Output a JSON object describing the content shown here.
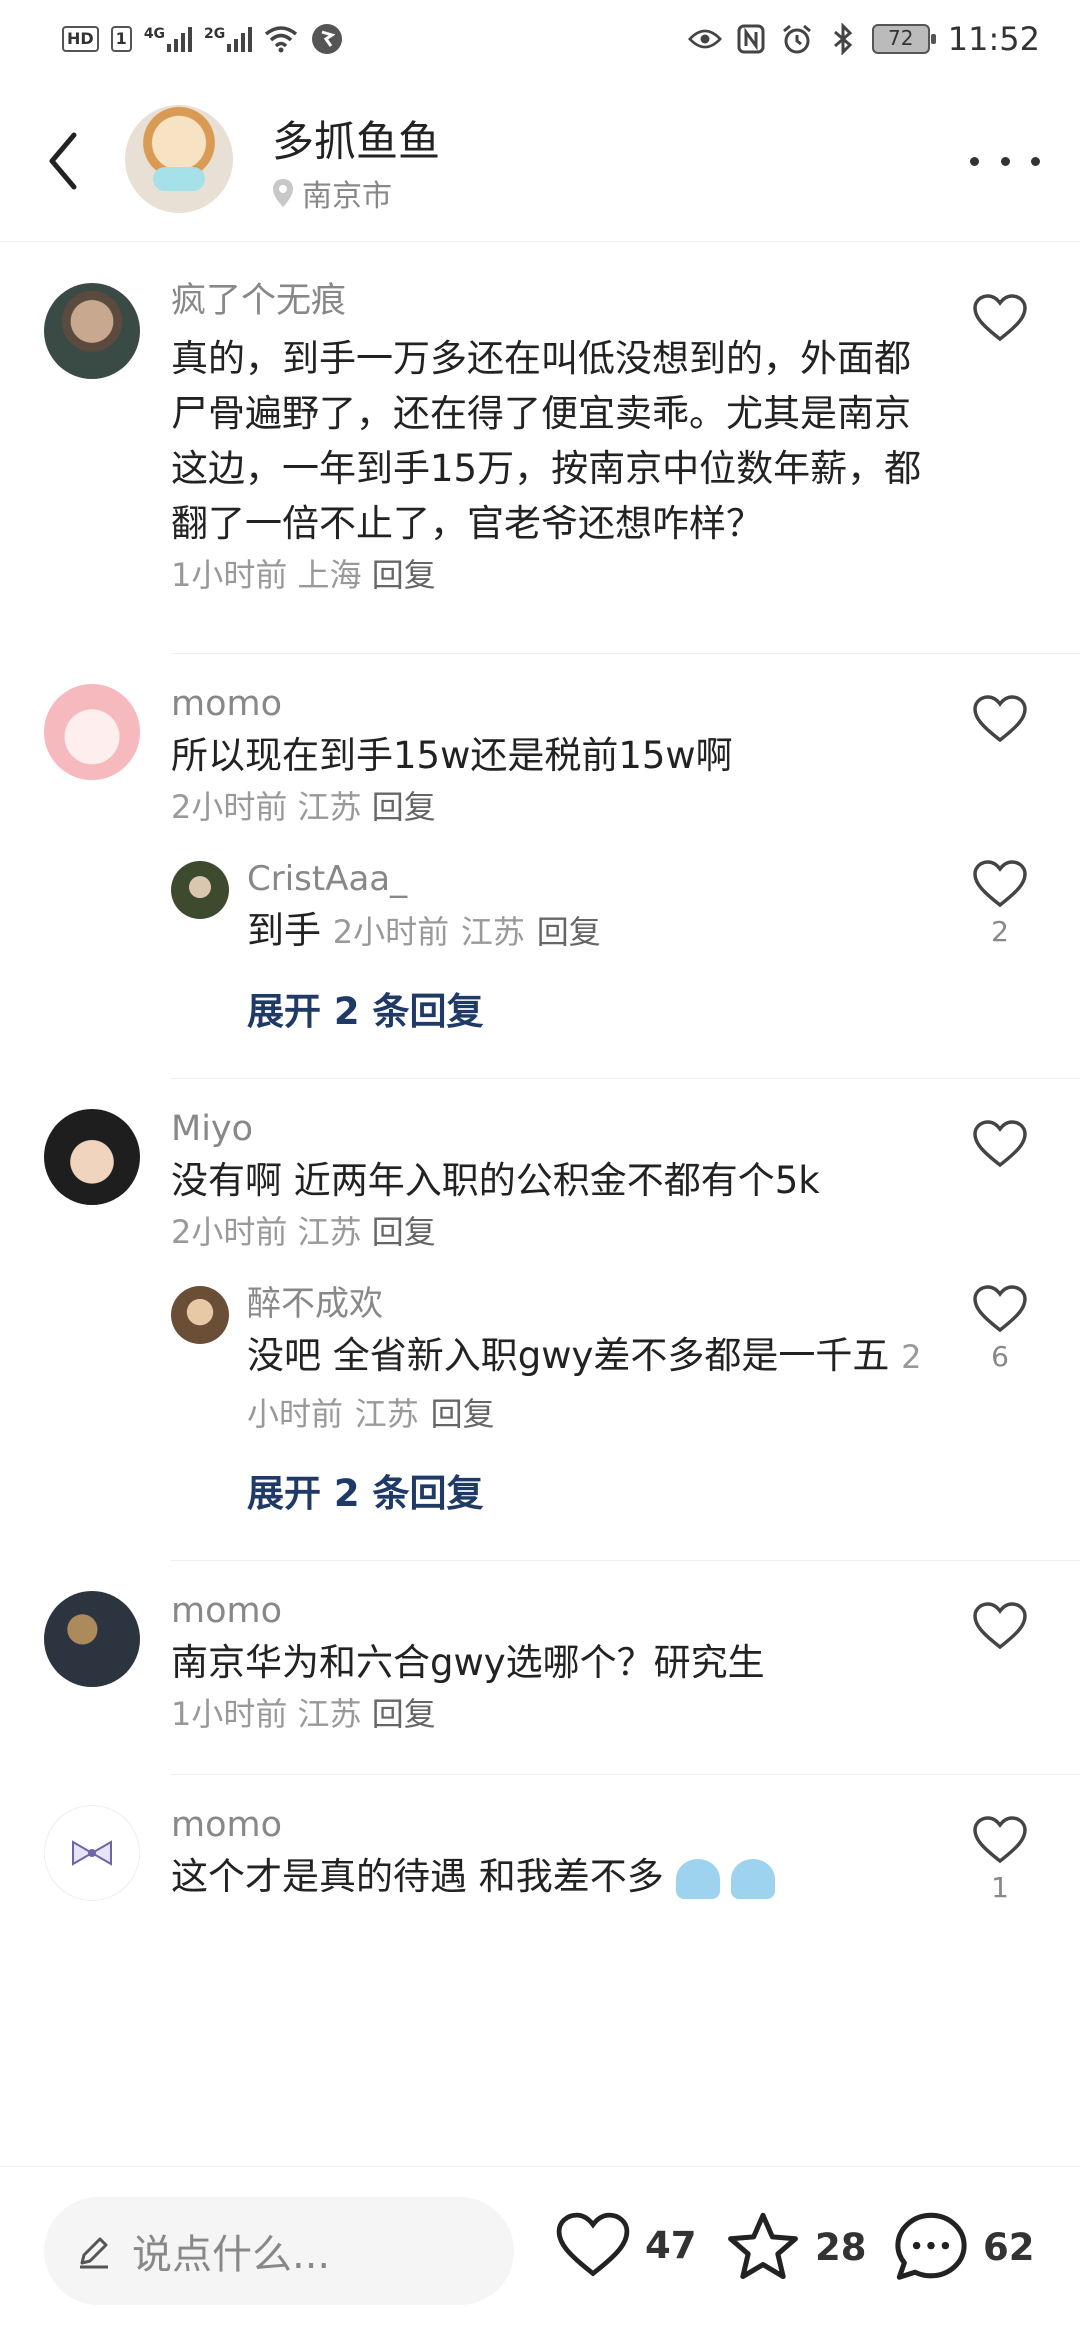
{
  "status_bar": {
    "hd_label": "HD",
    "sim_label": "1",
    "net1": "4G",
    "net2": "2G",
    "battery": "72",
    "time": "11:52"
  },
  "header": {
    "name": "多抓鱼鱼",
    "location": "南京市"
  },
  "comments": [
    {
      "user": "疯了个无痕",
      "text": "真的，到手一万多还在叫低没想到的，外面都尸骨遍野了，还在得了便宜卖乖。尤其是南京这边，一年到手15万，按南京中位数年薪，都翻了一倍不止了，官老爷还想咋样？",
      "time": "1小时前",
      "location": "上海",
      "reply": "回复"
    },
    {
      "user": "momo",
      "text": "所以现在到手15w还是税前15w啊",
      "time": "2小时前",
      "location": "江苏",
      "reply": "回复",
      "sub": {
        "user": "CristAaa_",
        "text": "到手",
        "time": "2小时前",
        "location": "江苏",
        "reply": "回复",
        "likes": "2"
      },
      "expand": "展开 2 条回复"
    },
    {
      "user": "Miyo",
      "text": "没有啊 近两年入职的公积金不都有个5k",
      "time": "2小时前",
      "location": "江苏",
      "reply": "回复",
      "sub": {
        "user": "醉不成欢",
        "text": "没吧 全省新入职gwy差不多都是一千五",
        "time": "2小时前",
        "location": "江苏",
        "reply": "回复",
        "likes": "6"
      },
      "expand": "展开 2 条回复"
    },
    {
      "user": "momo",
      "text": "南京华为和六合gwy选哪个？研究生",
      "time": "1小时前",
      "location": "江苏",
      "reply": "回复"
    },
    {
      "user": "momo",
      "text": "这个才是真的待遇 和我差不多",
      "likes": "1"
    }
  ],
  "bottom": {
    "placeholder": "说点什么...",
    "likes": "47",
    "stars": "28",
    "comments": "62"
  },
  "colors": {
    "accent": "#1f3a66",
    "muted": "#999999"
  }
}
